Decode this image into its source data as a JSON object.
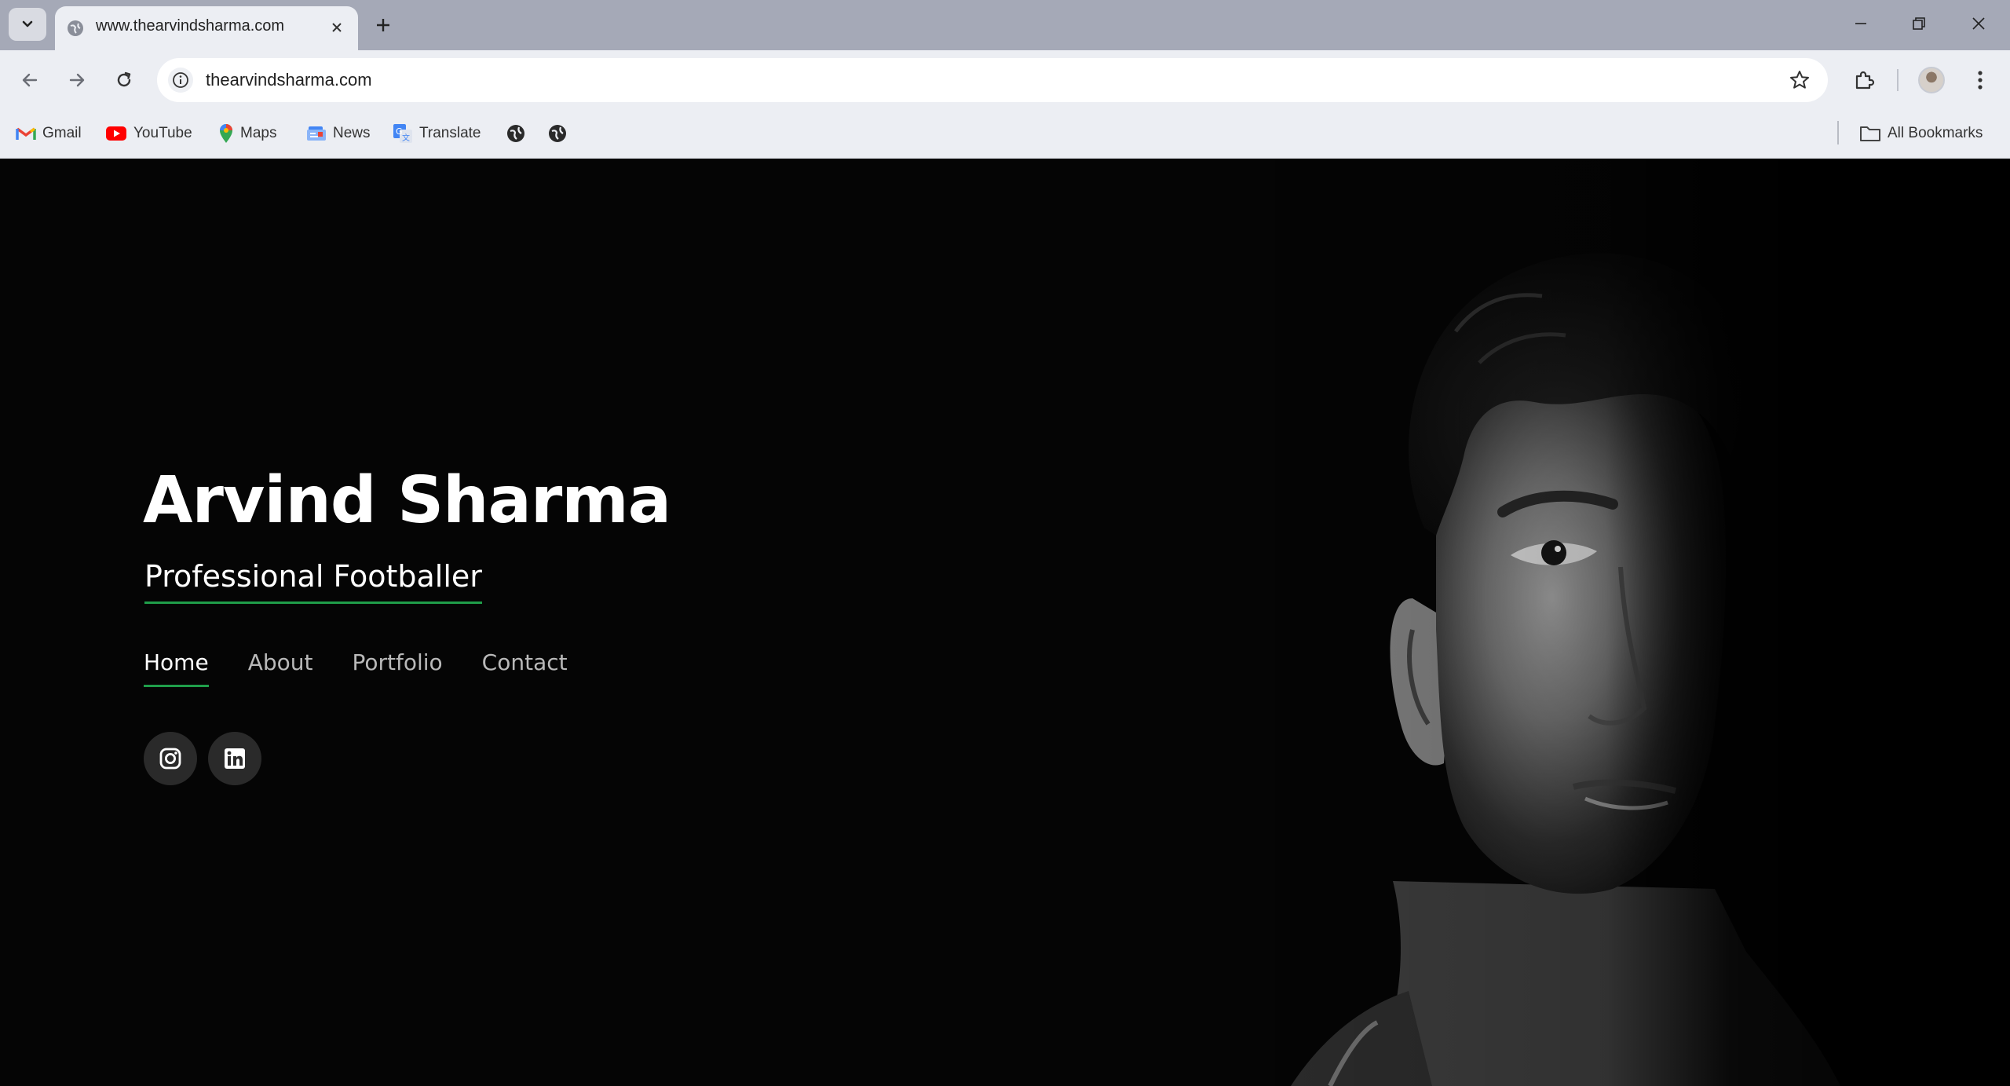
{
  "browser": {
    "tab_title": "www.thearvindsharma.com",
    "url": "thearvindsharma.com",
    "bookmarks": [
      {
        "label": "Gmail",
        "icon": "gmail-icon"
      },
      {
        "label": "YouTube",
        "icon": "youtube-icon"
      },
      {
        "label": "Maps",
        "icon": "maps-icon"
      },
      {
        "label": "News",
        "icon": "news-icon"
      },
      {
        "label": "Translate",
        "icon": "translate-icon"
      }
    ],
    "all_bookmarks_label": "All Bookmarks"
  },
  "hero": {
    "name": "Arvind Sharma",
    "role": "Professional Footballer",
    "accent_color": "#1f9e4a"
  },
  "nav": {
    "items": [
      {
        "label": "Home",
        "active": true
      },
      {
        "label": "About",
        "active": false
      },
      {
        "label": "Portfolio",
        "active": false
      },
      {
        "label": "Contact",
        "active": false
      }
    ]
  },
  "social": [
    {
      "name": "instagram-icon"
    },
    {
      "name": "linkedin-icon"
    }
  ]
}
